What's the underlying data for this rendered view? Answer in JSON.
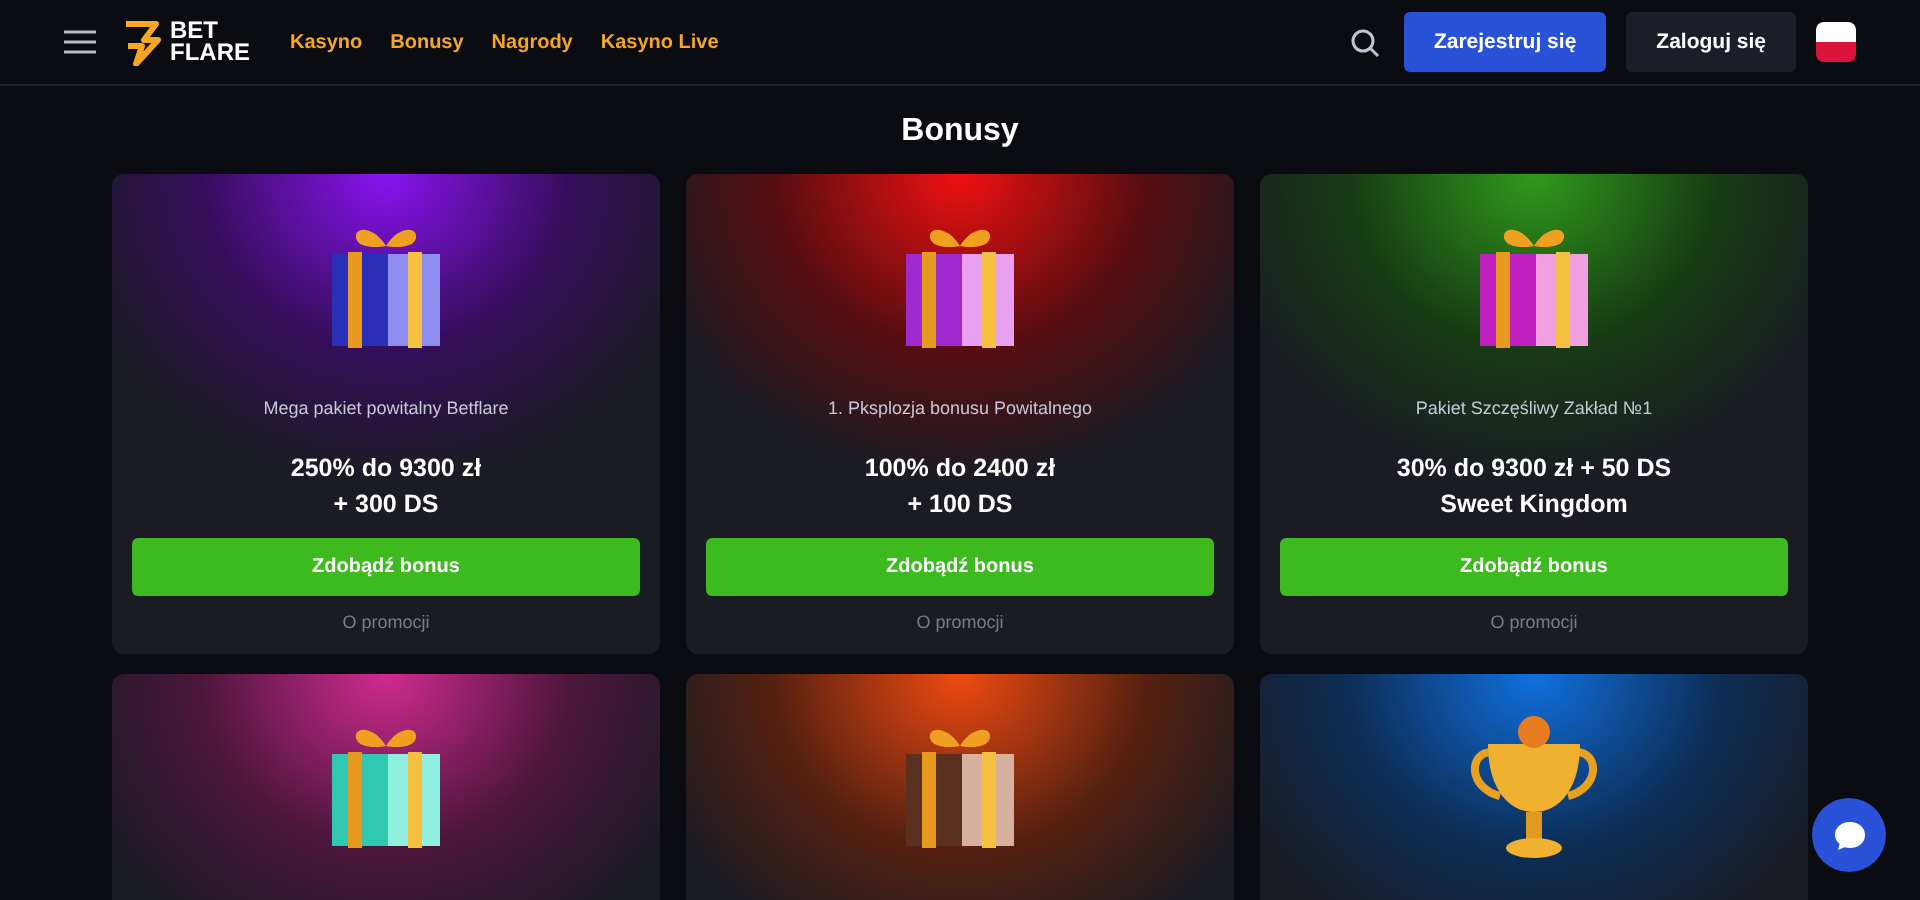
{
  "header": {
    "logo": {
      "line1": "BET",
      "line2": "FLARE"
    },
    "nav": [
      {
        "label": "Kasyno"
      },
      {
        "label": "Bonusy"
      },
      {
        "label": "Nagrody"
      },
      {
        "label": "Kasyno Live"
      }
    ],
    "register_button": "Zarejestruj się",
    "login_button": "Zaloguj się"
  },
  "page_title": "Bonusy",
  "cards": [
    {
      "color": "#8a12f0",
      "kind": "gift",
      "subtitle": "Mega pakiet powitalny Betflare",
      "offer": [
        "250% do 9300 zł",
        "+ 300 DS"
      ],
      "button": "Zdobądź bonus",
      "link": "O promocji"
    },
    {
      "color": "#f01010",
      "kind": "gift",
      "subtitle": "1. Pksplozja bonusu Powitalnego",
      "offer": [
        "100% do 2400 zł",
        "+ 100 DS"
      ],
      "button": "Zdobądź bonus",
      "link": "O promocji"
    },
    {
      "color": "#2f9a1a",
      "kind": "gift",
      "subtitle": "Pakiet Szczęśliwy Zakład №1",
      "offer": [
        "30% do 9300 zł + 50 DS",
        "Sweet Kingdom"
      ],
      "button": "Zdobądź bonus",
      "link": "O promocji"
    },
    {
      "color": "#d02a90",
      "kind": "gift"
    },
    {
      "color": "#f04a10",
      "kind": "gift"
    },
    {
      "color": "#1070e0",
      "kind": "trophy"
    }
  ]
}
